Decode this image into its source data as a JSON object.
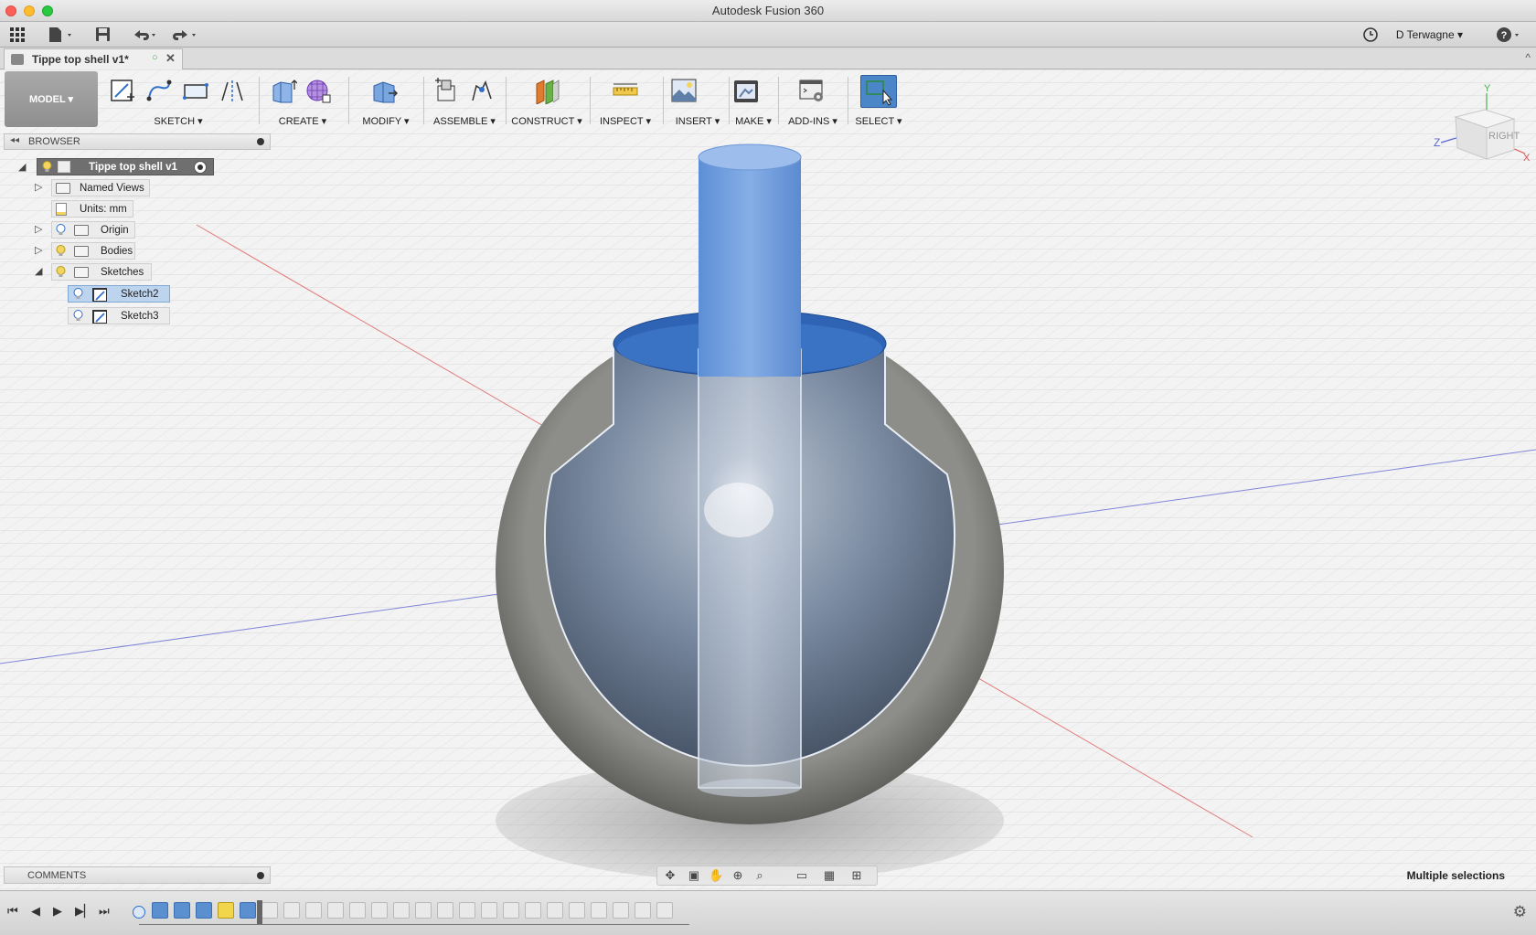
{
  "app_title": "Autodesk Fusion 360",
  "user": "D Terwagne",
  "document_tab": {
    "title": "Tippe top shell v1*"
  },
  "toolbar": {
    "workspace": "MODEL",
    "groups": [
      {
        "label": "SKETCH"
      },
      {
        "label": "CREATE"
      },
      {
        "label": "MODIFY"
      },
      {
        "label": "ASSEMBLE"
      },
      {
        "label": "CONSTRUCT"
      },
      {
        "label": "INSPECT"
      },
      {
        "label": "INSERT"
      },
      {
        "label": "MAKE"
      },
      {
        "label": "ADD-INS"
      },
      {
        "label": "SELECT"
      }
    ]
  },
  "browser": {
    "title": "BROWSER",
    "root": "Tippe top shell v1",
    "items": [
      {
        "label": "Named Views"
      },
      {
        "label": "Units: mm"
      },
      {
        "label": "Origin"
      },
      {
        "label": "Bodies"
      },
      {
        "label": "Sketches"
      },
      {
        "label": "Sketch2"
      },
      {
        "label": "Sketch3"
      }
    ]
  },
  "comments": {
    "title": "COMMENTS"
  },
  "viewcube": {
    "face": "RIGHT",
    "axes": [
      "Y",
      "Z",
      "X"
    ]
  },
  "status": "Multiple selections",
  "colors": {
    "accent": "#4a86c8",
    "selection": "#bcd4ee",
    "body": "#8a8f96"
  },
  "timeline_items": 24
}
